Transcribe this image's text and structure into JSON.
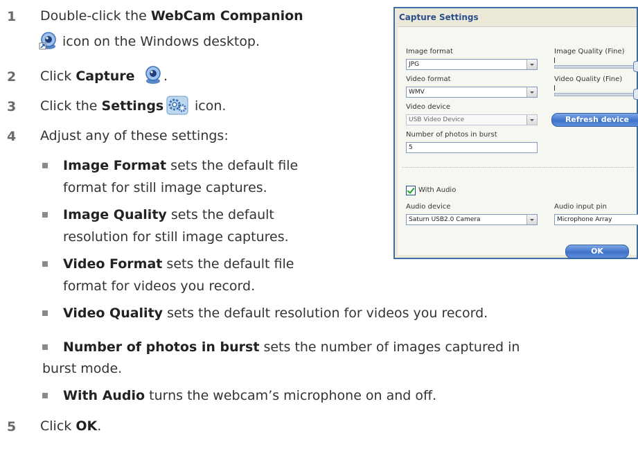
{
  "steps": [
    {
      "num": "1",
      "pre": "Double-click the ",
      "bold": "WebCam Companion",
      "line2": "icon on the Windows desktop."
    },
    {
      "num": "2",
      "pre": "Click ",
      "bold": "Capture",
      "post": "."
    },
    {
      "num": "3",
      "pre": "Click the ",
      "bold": "Settings",
      "post": "icon."
    },
    {
      "num": "4",
      "pre": "Adjust any of these settings:"
    },
    {
      "num": "5",
      "pre": "Click ",
      "bold": "OK",
      "post": "."
    }
  ],
  "bullets": [
    {
      "term": "Image Format",
      "line1": " sets the default file",
      "line2": "format for still image captures."
    },
    {
      "term": "Image Quality",
      "line1": " sets the default",
      "line2": "resolution for still image captures."
    },
    {
      "term": "Video Format",
      "line1": " sets the default file",
      "line2": "format for videos you record."
    },
    {
      "term": "Video Quality",
      "line1": " sets the default resolution for videos you record."
    },
    {
      "term": "Number of photos in burst",
      "line1": " sets the number of images captured in",
      "line2": "burst mode."
    },
    {
      "term": "With Audio",
      "line1": " turns the webcam’s microphone on and off."
    }
  ],
  "dialog": {
    "title": "Capture Settings",
    "image_format_label": "Image format",
    "image_format_value": "JPG",
    "video_format_label": "Video format",
    "video_format_value": "WMV",
    "video_device_label": "Video device",
    "video_device_value": "USB Video Device",
    "burst_label": "Number of photos in burst",
    "burst_value": "5",
    "image_quality_label": "Image Quality (Fine)",
    "video_quality_label": "Video Quality (Fine)",
    "refresh_label": "Refresh device",
    "with_audio_label": "With Audio",
    "with_audio_checked": true,
    "audio_device_label": "Audio device",
    "audio_device_value": "Saturn USB2.0 Camera",
    "audio_pin_label": "Audio input pin",
    "audio_pin_value": "Microphone Array",
    "ok_label": "OK"
  },
  "icons": {
    "webcam_companion": "webcam-icon",
    "capture": "webcam-icon",
    "settings": "settings-gear-icon"
  },
  "colors": {
    "step_number": "#6a6a6a",
    "dialog_border": "#3b6ea5",
    "button_blue": "#3f73c8"
  }
}
